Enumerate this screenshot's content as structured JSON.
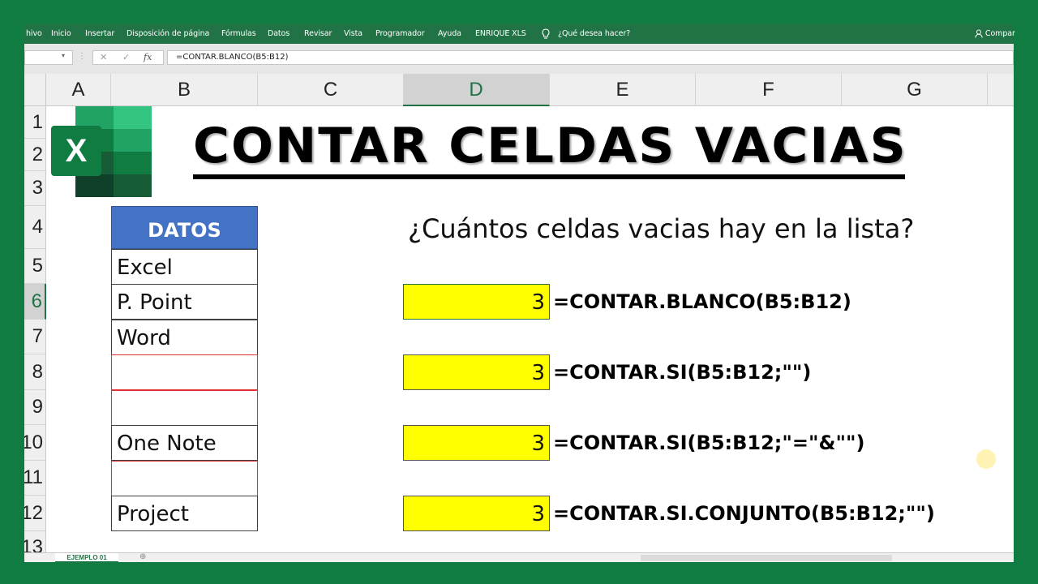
{
  "ribbon": {
    "tabs": [
      "hivo",
      "Inicio",
      "Insertar",
      "Disposición de página",
      "Fórmulas",
      "Datos",
      "Revisar",
      "Vista",
      "Programador",
      "Ayuda",
      "ENRIQUE XLS"
    ],
    "tell_me": "¿Qué desea hacer?",
    "share": "Compar"
  },
  "formula_bar": {
    "cancel_glyph": "✕",
    "enter_glyph": "✓",
    "fx_label": "fx",
    "formula": "=CONTAR.BLANCO(B5:B12)"
  },
  "columns": [
    "A",
    "B",
    "C",
    "D",
    "E",
    "F",
    "G"
  ],
  "rows": [
    "1",
    "2",
    "3",
    "4",
    "5",
    "6",
    "7",
    "8",
    "9",
    "10",
    "11",
    "12",
    "13"
  ],
  "selected_column": "D",
  "selected_row": "6",
  "title": "CONTAR CELDAS VACIAS",
  "logo_letter": "X",
  "data_table": {
    "header": "DATOS",
    "cells": [
      "Excel",
      "P. Point",
      "Word",
      "",
      "",
      "One Note",
      "",
      "Project"
    ]
  },
  "question": "¿Cuántos celdas vacias hay en la lista?",
  "results": [
    {
      "value": "3",
      "formula": "=CONTAR.BLANCO(B5:B12)"
    },
    {
      "value": "3",
      "formula": "=CONTAR.SI(B5:B12;\"\")"
    },
    {
      "value": "3",
      "formula": "=CONTAR.SI(B5:B12;\"=\"&\"\")"
    },
    {
      "value": "3",
      "formula": "=CONTAR.SI.CONJUNTO(B5:B12;\"\")"
    }
  ],
  "sheet_tab": "EJEMPLO 01",
  "colors": {
    "excel_green": "#217346",
    "header_blue": "#4472c4",
    "result_yellow": "#ffff00",
    "empty_border_red": "#e03030"
  }
}
